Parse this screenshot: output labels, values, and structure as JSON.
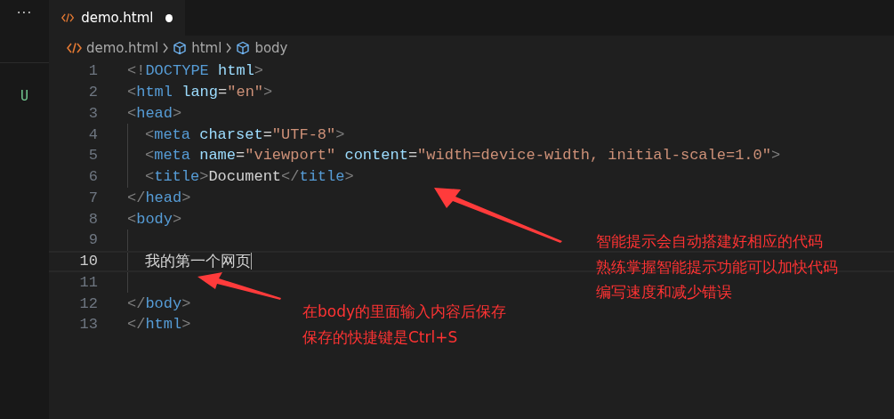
{
  "sidebar": {
    "more": "···",
    "items": [
      {
        "status": "U"
      }
    ]
  },
  "tabs": [
    {
      "label": "demo.html",
      "selected": true,
      "modified": true
    }
  ],
  "breadcrumb": [
    {
      "kind": "file",
      "label": "demo.html"
    },
    {
      "kind": "element",
      "label": "html"
    },
    {
      "kind": "element",
      "label": "body"
    }
  ],
  "editor": {
    "lines": [
      {
        "number": "1",
        "indented": false,
        "current": false,
        "tokens": [
          {
            "kind": "punct",
            "text": "<!"
          },
          {
            "kind": "tag",
            "text": "DOCTYPE"
          },
          {
            "kind": "attr",
            "text": " html"
          },
          {
            "kind": "punct",
            "text": ">"
          }
        ]
      },
      {
        "number": "2",
        "indented": false,
        "current": false,
        "tokens": [
          {
            "kind": "punct",
            "text": "<"
          },
          {
            "kind": "tag",
            "text": "html"
          },
          {
            "kind": "attr",
            "text": " lang"
          },
          {
            "kind": "text",
            "text": "="
          },
          {
            "kind": "string",
            "text": "\"en\""
          },
          {
            "kind": "punct",
            "text": ">"
          }
        ]
      },
      {
        "number": "3",
        "indented": false,
        "current": false,
        "tokens": [
          {
            "kind": "punct",
            "text": "<"
          },
          {
            "kind": "tag",
            "text": "head"
          },
          {
            "kind": "punct",
            "text": ">"
          }
        ]
      },
      {
        "number": "4",
        "indented": true,
        "current": false,
        "tokens": [
          {
            "kind": "punct",
            "text": "<"
          },
          {
            "kind": "tag",
            "text": "meta"
          },
          {
            "kind": "attr",
            "text": " charset"
          },
          {
            "kind": "text",
            "text": "="
          },
          {
            "kind": "string",
            "text": "\"UTF-8\""
          },
          {
            "kind": "punct",
            "text": ">"
          }
        ]
      },
      {
        "number": "5",
        "indented": true,
        "current": false,
        "tokens": [
          {
            "kind": "punct",
            "text": "<"
          },
          {
            "kind": "tag",
            "text": "meta"
          },
          {
            "kind": "attr",
            "text": " name"
          },
          {
            "kind": "text",
            "text": "="
          },
          {
            "kind": "string",
            "text": "\"viewport\""
          },
          {
            "kind": "attr",
            "text": " content"
          },
          {
            "kind": "text",
            "text": "="
          },
          {
            "kind": "string",
            "text": "\"width=device-width, initial-scale=1.0\""
          },
          {
            "kind": "punct",
            "text": ">"
          }
        ]
      },
      {
        "number": "6",
        "indented": true,
        "current": false,
        "tokens": [
          {
            "kind": "punct",
            "text": "<"
          },
          {
            "kind": "tag",
            "text": "title"
          },
          {
            "kind": "punct",
            "text": ">"
          },
          {
            "kind": "text",
            "text": "Document"
          },
          {
            "kind": "punct",
            "text": "</"
          },
          {
            "kind": "tag",
            "text": "title"
          },
          {
            "kind": "punct",
            "text": ">"
          }
        ]
      },
      {
        "number": "7",
        "indented": false,
        "current": false,
        "tokens": [
          {
            "kind": "punct",
            "text": "</"
          },
          {
            "kind": "tag",
            "text": "head"
          },
          {
            "kind": "punct",
            "text": ">"
          }
        ]
      },
      {
        "number": "8",
        "indented": false,
        "current": false,
        "tokens": [
          {
            "kind": "punct",
            "text": "<"
          },
          {
            "kind": "tag",
            "text": "body"
          },
          {
            "kind": "punct",
            "text": ">"
          }
        ]
      },
      {
        "number": "9",
        "indented": true,
        "current": false
      },
      {
        "number": "10",
        "indented": true,
        "current": true,
        "tokens": [
          {
            "kind": "text",
            "text": "我的第一个网页"
          }
        ]
      },
      {
        "number": "11",
        "indented": true,
        "current": false
      },
      {
        "number": "12",
        "indented": false,
        "current": false,
        "tokens": [
          {
            "kind": "punct",
            "text": "</"
          },
          {
            "kind": "tag",
            "text": "body"
          },
          {
            "kind": "punct",
            "text": ">"
          }
        ]
      },
      {
        "number": "13",
        "indented": false,
        "current": false,
        "tokens": [
          {
            "kind": "punct",
            "text": "</"
          },
          {
            "kind": "tag",
            "text": "html"
          },
          {
            "kind": "punct",
            "text": ">"
          }
        ]
      }
    ]
  },
  "annotations": [
    {
      "lines": [
        "智能提示会自动搭建好相应的代码",
        "熟练掌握智能提示功能可以加快代码",
        "编写速度和减少错误"
      ]
    },
    {
      "lines": [
        "在body的里面输入内容后保存",
        "保存的快捷键是Ctrl+S"
      ]
    }
  ]
}
